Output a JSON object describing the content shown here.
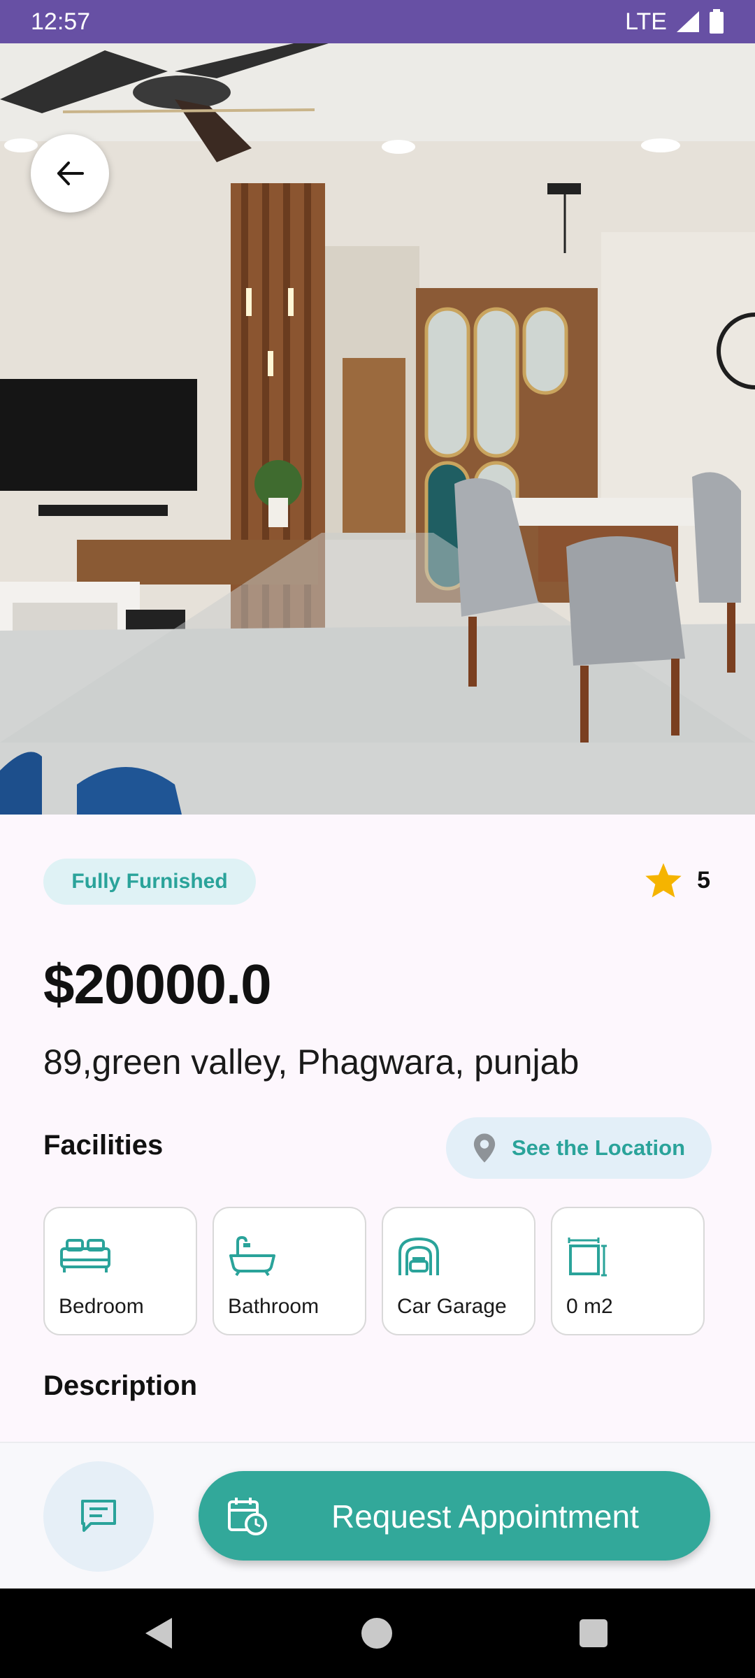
{
  "status_bar": {
    "time": "12:57",
    "network": "LTE",
    "icons": [
      "signal-icon",
      "battery-icon"
    ]
  },
  "hero": {
    "image": "apartment-interior-photo",
    "back_icon": "arrow-left-icon"
  },
  "listing": {
    "furnishing": "Fully Furnished",
    "rating": "5",
    "rating_icon": "star-icon",
    "price": "$20000.0",
    "address": "89,green valley, Phagwara, punjab"
  },
  "facilities": {
    "title": "Facilities",
    "location_button": "See the Location",
    "location_icon": "map-pin-icon",
    "items": [
      {
        "label": "Bedroom",
        "icon": "bed-icon"
      },
      {
        "label": "Bathroom",
        "icon": "bathtub-icon"
      },
      {
        "label": "Car Garage",
        "icon": "garage-icon"
      },
      {
        "label": "0 m2",
        "icon": "area-icon"
      }
    ]
  },
  "description": {
    "title": "Description"
  },
  "actions": {
    "chat_icon": "chat-icon",
    "appointment_label": "Request Appointment",
    "appointment_icon": "calendar-clock-icon"
  },
  "colors": {
    "accent": "#32a89a",
    "status_bar": "#6750a4",
    "chip_bg": "#dff2f5",
    "star": "#f5b400"
  }
}
